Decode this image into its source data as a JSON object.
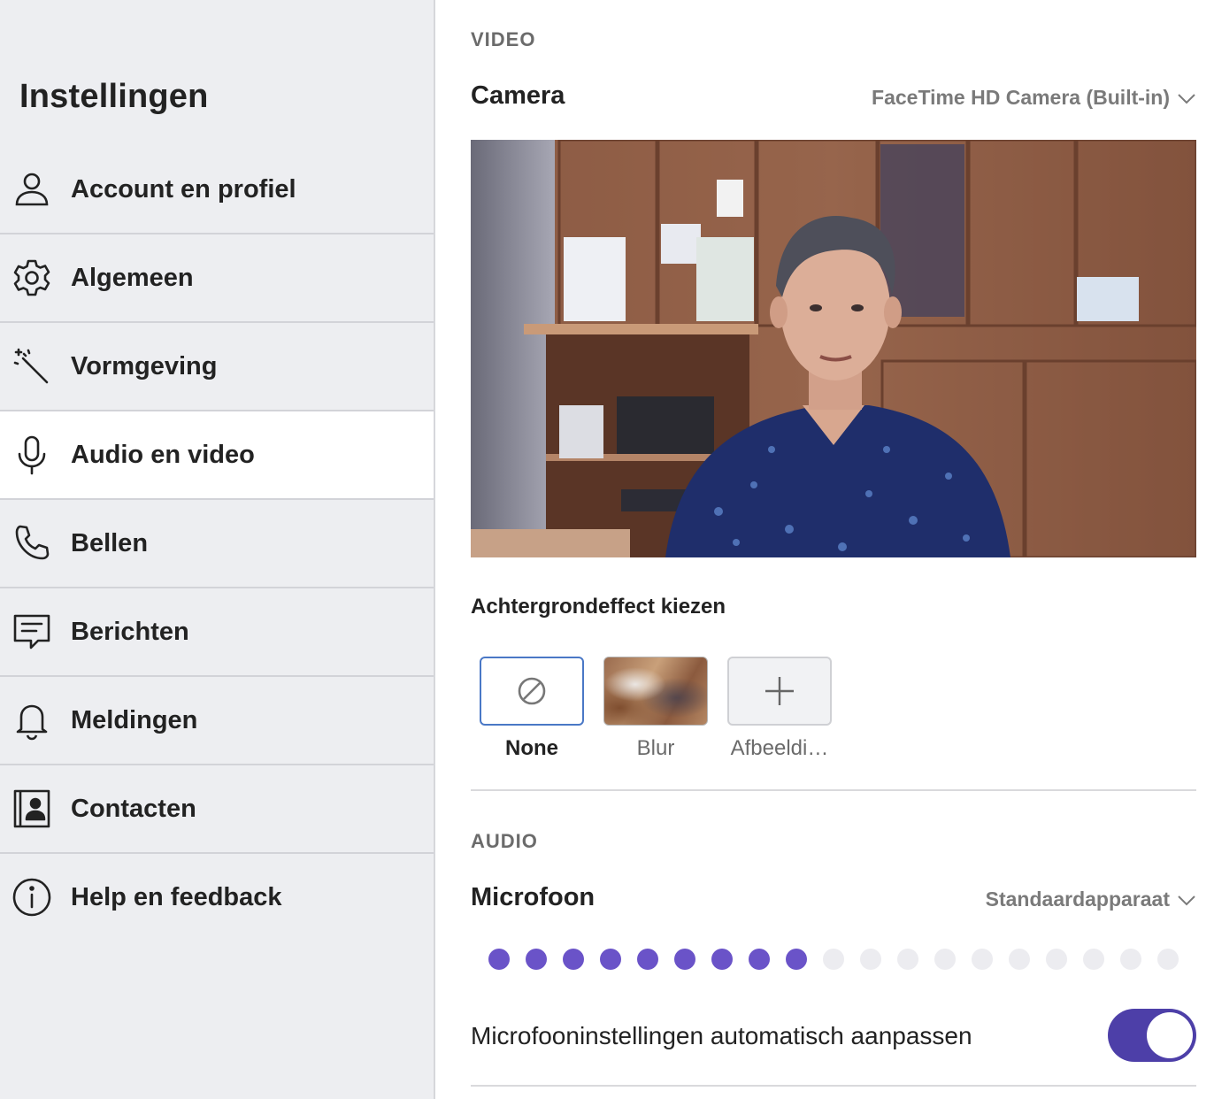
{
  "sidebar": {
    "title": "Instellingen",
    "items": [
      {
        "label": "Account en profiel",
        "icon": "person-icon"
      },
      {
        "label": "Algemeen",
        "icon": "gear-icon"
      },
      {
        "label": "Vormgeving",
        "icon": "magic-wand-icon"
      },
      {
        "label": "Audio en video",
        "icon": "microphone-icon",
        "active": true
      },
      {
        "label": "Bellen",
        "icon": "phone-icon"
      },
      {
        "label": "Berichten",
        "icon": "message-icon"
      },
      {
        "label": "Meldingen",
        "icon": "bell-icon"
      },
      {
        "label": "Contacten",
        "icon": "contact-book-icon"
      },
      {
        "label": "Help en feedback",
        "icon": "info-icon"
      }
    ]
  },
  "video": {
    "section_label": "VIDEO",
    "camera_label": "Camera",
    "camera_device": "FaceTime HD Camera (Built-in)",
    "background_effect_title": "Achtergrondeffect kiezen",
    "effects": [
      {
        "label": "None",
        "icon": "none-icon",
        "selected": true
      },
      {
        "label": "Blur",
        "icon": "blur-thumbnail"
      },
      {
        "label": "Afbeeldi…",
        "icon": "plus-icon"
      }
    ]
  },
  "audio": {
    "section_label": "AUDIO",
    "microphone_label": "Microfoon",
    "microphone_device": "Standaardapparaat",
    "mic_level": {
      "active_dots": 9,
      "total_dots": 19
    },
    "auto_adjust_label": "Microfooninstellingen automatisch aanpassen",
    "auto_adjust_on": true
  },
  "colors": {
    "accent": "#4d3fa8",
    "level_active": "#6a53c8",
    "level_inactive": "#ececf0",
    "sidebar_bg": "#edeef1",
    "selected_border": "#4a78c6"
  }
}
